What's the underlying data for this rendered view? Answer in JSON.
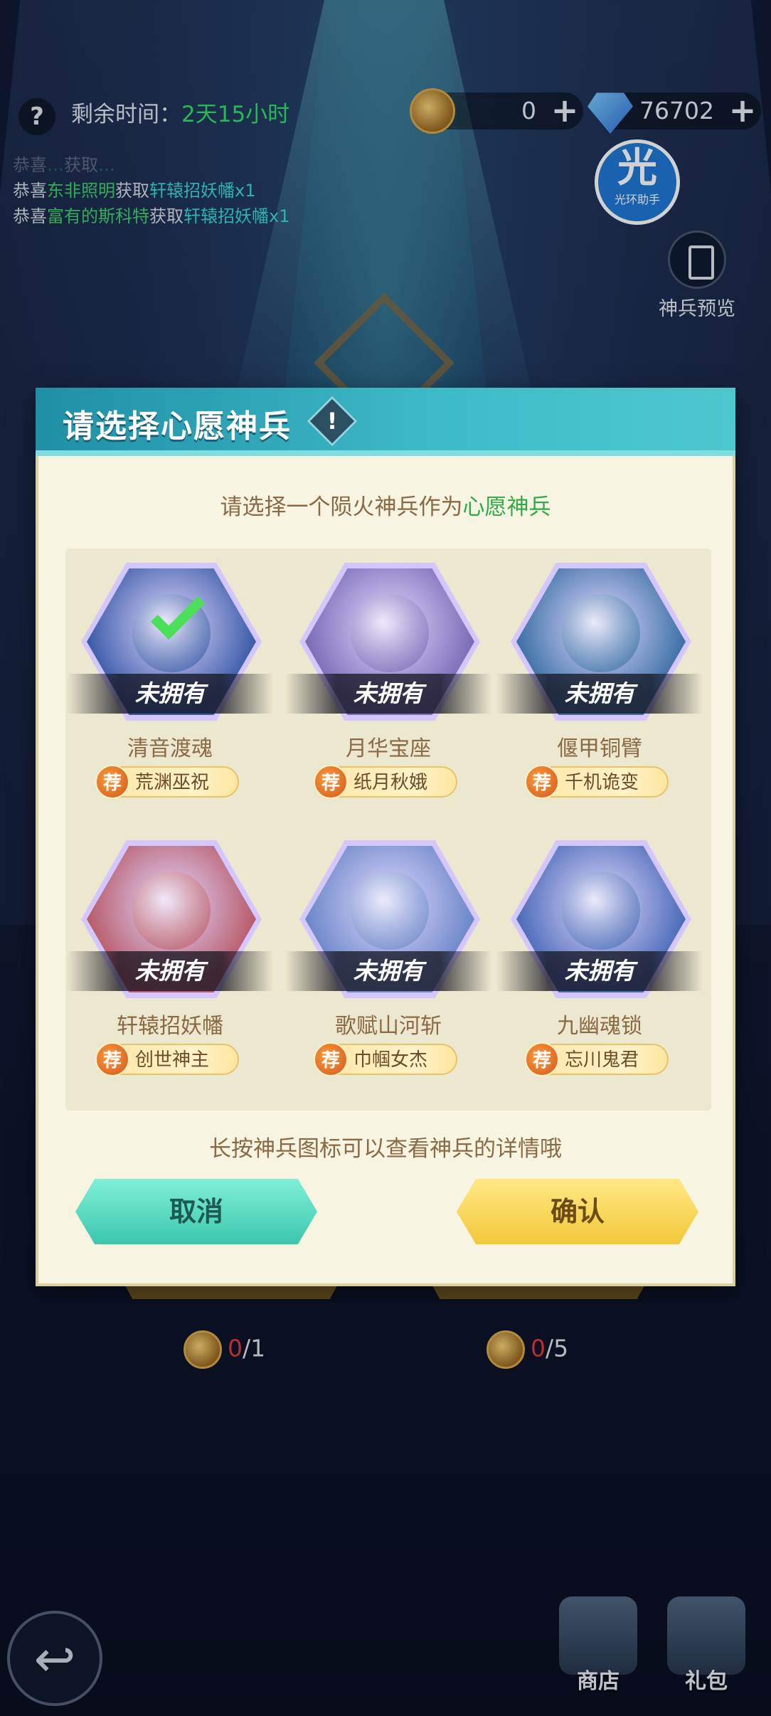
{
  "topbar": {
    "help_glyph": "?",
    "remaining_label": "剩余时间：",
    "remaining_value": "2天15小时",
    "currency1_value": "0",
    "currency2_value": "76702",
    "plus_glyph": "+"
  },
  "ticker": [
    {
      "prefix": "恭喜",
      "name": "…",
      "mid": "获取",
      "item": "…"
    },
    {
      "prefix": "恭喜",
      "name": "东非照明",
      "mid": "获取",
      "item": "轩辕招妖幡x1"
    },
    {
      "prefix": "恭喜",
      "name": "富有的斯科特",
      "mid": "获取",
      "item": "轩辕招妖幡x1"
    }
  ],
  "helper": {
    "big": "光",
    "small": "光环助手"
  },
  "preview": {
    "label": "神兵预览"
  },
  "dialog": {
    "title": "请选择心愿神兵",
    "warn_glyph": "!",
    "subtitle_prefix": "请选择一个陨火神兵作为",
    "subtitle_highlight": "心愿神兵",
    "rec_badge": "荐",
    "weapons": [
      {
        "name": "清音渡魂",
        "status": "未拥有",
        "hero": "荒渊巫祝",
        "selected": true,
        "color": "#3a5aa8"
      },
      {
        "name": "月华宝座",
        "status": "未拥有",
        "hero": "纸月秋娥",
        "selected": false,
        "color": "#7a6ab8"
      },
      {
        "name": "偃甲铜臂",
        "status": "未拥有",
        "hero": "千机诡变",
        "selected": false,
        "color": "#3b6fa6"
      },
      {
        "name": "轩辕招妖幡",
        "status": "未拥有",
        "hero": "创世神主",
        "selected": false,
        "color": "#b85a6a"
      },
      {
        "name": "歌赋山河斩",
        "status": "未拥有",
        "hero": "巾帼女杰",
        "selected": false,
        "color": "#6a86c8"
      },
      {
        "name": "九幽魂锁",
        "status": "未拥有",
        "hero": "忘川鬼君",
        "selected": false,
        "color": "#4a6ab8"
      }
    ],
    "hint": "长按神兵图标可以查看神兵的详情哦",
    "cancel_label": "取消",
    "confirm_label": "确认"
  },
  "costs": [
    {
      "have": "0",
      "need": "/1"
    },
    {
      "have": "0",
      "need": "/5"
    }
  ],
  "dock": {
    "back_glyph": "↩",
    "shop_label": "商店",
    "gift_label": "礼包"
  },
  "colors": {
    "accent_teal": "#3fbcc9",
    "highlight_green": "#2faa4a",
    "confirm_yellow": "#f3c83a",
    "cancel_teal": "#3cc7ae"
  }
}
